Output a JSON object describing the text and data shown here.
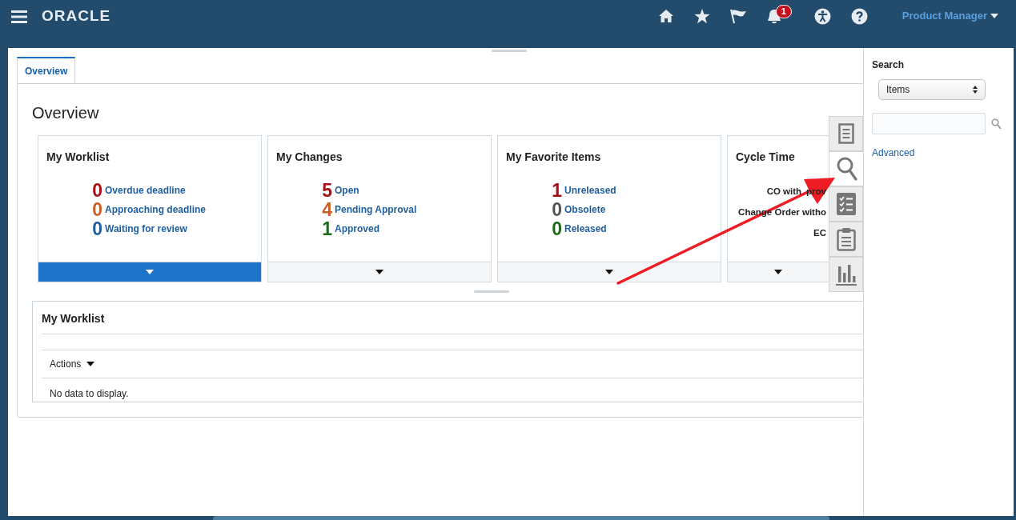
{
  "header": {
    "logo": "ORACLE",
    "notification_count": "1",
    "user_menu": "Product Manager"
  },
  "tabs": [
    {
      "label": "Overview",
      "selected": true
    }
  ],
  "page_title": "Overview",
  "cards": [
    {
      "title": "My Worklist",
      "selected": true,
      "kind": "counts",
      "items": [
        {
          "count": "0",
          "label": "Overdue deadline",
          "color": "#a50f15"
        },
        {
          "count": "0",
          "label": "Approaching deadline",
          "color": "#c8602a"
        },
        {
          "count": "0",
          "label": "Waiting for review",
          "color": "#1f5f9e"
        }
      ]
    },
    {
      "title": "My Changes",
      "selected": false,
      "kind": "counts",
      "items": [
        {
          "count": "5",
          "label": "Open",
          "color": "#a50f15"
        },
        {
          "count": "4",
          "label": "Pending Approval",
          "color": "#c8602a"
        },
        {
          "count": "1",
          "label": "Approved",
          "color": "#1e6b1e"
        }
      ]
    },
    {
      "title": "My Favorite Items",
      "selected": false,
      "kind": "counts",
      "items": [
        {
          "count": "1",
          "label": "Unreleased",
          "color": "#a50f15"
        },
        {
          "count": "0",
          "label": "Obsolete",
          "color": "#555555"
        },
        {
          "count": "0",
          "label": "Released",
          "color": "#1e6b1e"
        }
      ]
    },
    {
      "title": "Cycle Time",
      "selected": false,
      "kind": "text",
      "lines": [
        [
          "CO with",
          "prov"
        ],
        [
          "Change Order witho"
        ],
        [
          "EC"
        ]
      ]
    }
  ],
  "side_tabs": [
    {
      "selected": false
    },
    {
      "selected": true
    },
    {
      "selected": false
    },
    {
      "selected": false
    },
    {
      "selected": false
    }
  ],
  "worklist": {
    "title": "My Worklist",
    "actions": "Actions",
    "empty_message": "No data to display."
  },
  "search_panel": {
    "title": "Search",
    "select_value": "Items",
    "link": "Advanced"
  }
}
